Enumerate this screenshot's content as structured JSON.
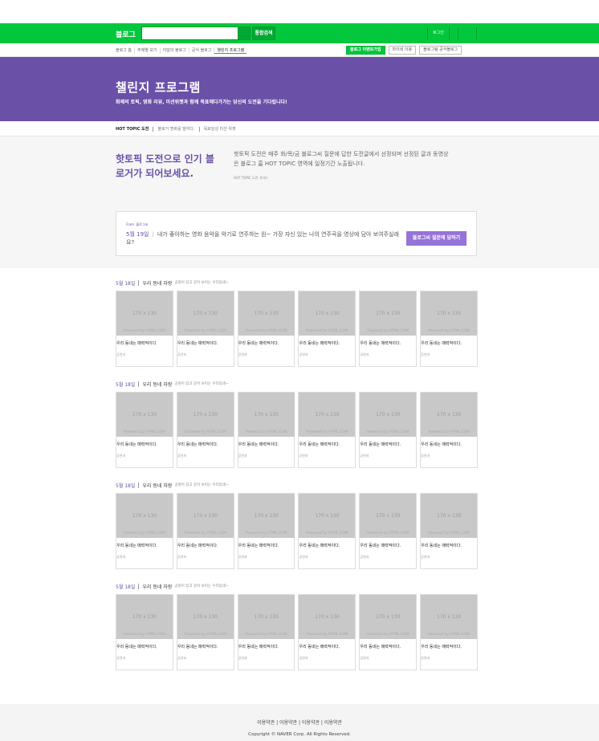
{
  "gnb": {
    "logo": "블로그",
    "search_button": "통합검색",
    "login": "로그인"
  },
  "lnb": {
    "menu": [
      "블로그 홈",
      "주제별 보기",
      "이달의 블로그",
      "공식 블로그",
      "챌린지 프로그램"
    ],
    "buttons": {
      "join": "블로그 이벤트가입",
      "mystore": "마이네 이용",
      "official": "블로그팀 공식블로그"
    }
  },
  "hero": {
    "title": "챌린지 프로그램",
    "subtitle": "화제의 토픽, 영화 리뷰, 미션위젯과 함께 목표에다가가는 당신의 도전을 기다립니다!"
  },
  "tabs": [
    "HOT TOPIC 도전",
    "블로거 명화를 말하다.",
    "목표달성 미션 위젯"
  ],
  "intro": {
    "headline": "핫토픽 도전으로 인기 블로거가 되어보세요.",
    "description": "핫토픽 도전은 매주 화/목/금 블로그씨 질문에 답한 도전글에서 선정되며 선정된 글과 동영상은 블로그 홈 HOT TOPIC 영역에 일정기간 노출됩니다.",
    "guide": "HOT TOPIC 도전 가이드",
    "question": {
      "from": "From. 블로그씨",
      "date": "5월 19일",
      "text": "내가 좋아하는 영화 음악을 악기로 연주하는 원~ 가장 자신 있는 나의 연주곡을 영상에 담아 보여주실래요?",
      "button": "블로그씨 질문에 답하기"
    }
  },
  "groups": [
    {
      "date": "5월 18일",
      "title": "우리 동네 자랑",
      "subtitle": "공원이 있고 강이 보이는 우리동네~",
      "cards": [
        {
          "size": "170 x 130",
          "powered": "Powered by HTML.COM",
          "title": "우리 동네는 매력적이다.",
          "author": "공연과"
        },
        {
          "size": "170 x 130",
          "powered": "Powered by HTML.COM",
          "title": "우리 동네는 매력적이다.",
          "author": "공연과"
        },
        {
          "size": "170 x 130",
          "powered": "Powered by HTML.COM",
          "title": "우리 동네는 매력적이다.",
          "author": "공연과"
        },
        {
          "size": "170 x 130",
          "powered": "Powered by HTML.COM",
          "title": "우리 동네는 매력적이다.",
          "author": "공연과"
        },
        {
          "size": "170 x 130",
          "powered": "Powered by HTML.COM",
          "title": "우리 동네는 매력적이다.",
          "author": "공연과"
        },
        {
          "size": "170 x 130",
          "powered": "Powered by HTML.COM",
          "title": "우리 동네는 매력적이다.",
          "author": "공연과"
        }
      ]
    },
    {
      "date": "5월 18일",
      "title": "우리 동네 자랑",
      "subtitle": "공원이 있고 강이 보이는 우리동네~",
      "cards": [
        {
          "size": "170 x 130",
          "powered": "Powered by HTML.COM",
          "title": "우리 동네는 매력적이다.",
          "author": "공연과"
        },
        {
          "size": "170 x 130",
          "powered": "Powered by HTML.COM",
          "title": "우리 동네는 매력적이다.",
          "author": "공연과"
        },
        {
          "size": "170 x 130",
          "powered": "Powered by HTML.COM",
          "title": "우리 동네는 매력적이다.",
          "author": "공연과"
        },
        {
          "size": "170 x 130",
          "powered": "Powered by HTML.COM",
          "title": "우리 동네는 매력적이다.",
          "author": "공연과"
        },
        {
          "size": "170 x 130",
          "powered": "Powered by HTML.COM",
          "title": "우리 동네는 매력적이다.",
          "author": "공연과"
        },
        {
          "size": "170 x 130",
          "powered": "Powered by HTML.COM",
          "title": "우리 동네는 매력적이다.",
          "author": "공연과"
        }
      ]
    },
    {
      "date": "5월 18일",
      "title": "우리 동네 자랑",
      "subtitle": "공원이 있고 강이 보이는 우리동네~",
      "cards": [
        {
          "size": "170 x 130",
          "powered": "Powered by HTML.COM",
          "title": "우리 동네는 매력적이다.",
          "author": "공연과"
        },
        {
          "size": "170 x 130",
          "powered": "Powered by HTML.COM",
          "title": "우리 동네는 매력적이다.",
          "author": "공연과"
        },
        {
          "size": "170 x 130",
          "powered": "Powered by HTML.COM",
          "title": "우리 동네는 매력적이다.",
          "author": "공연과"
        },
        {
          "size": "170 x 130",
          "powered": "Powered by HTML.COM",
          "title": "우리 동네는 매력적이다.",
          "author": "공연과"
        },
        {
          "size": "170 x 130",
          "powered": "Powered by HTML.COM",
          "title": "우리 동네는 매력적이다.",
          "author": "공연과"
        },
        {
          "size": "170 x 130",
          "powered": "Powered by HTML.COM",
          "title": "우리 동네는 매력적이다.",
          "author": "공연과"
        }
      ]
    },
    {
      "date": "5월 18일",
      "title": "우리 동네 자랑",
      "subtitle": "공원이 있고 강이 보이는 우리동네~",
      "cards": [
        {
          "size": "170 x 130",
          "powered": "Powered by HTML.COM",
          "title": "우리 동네는 매력적이다.",
          "author": "공연과"
        },
        {
          "size": "170 x 130",
          "powered": "Powered by HTML.COM",
          "title": "우리 동네는 매력적이다.",
          "author": "공연과"
        },
        {
          "size": "170 x 130",
          "powered": "Powered by HTML.COM",
          "title": "우리 동네는 매력적이다.",
          "author": "공연과"
        },
        {
          "size": "170 x 130",
          "powered": "Powered by HTML.COM",
          "title": "우리 동네는 매력적이다.",
          "author": "공연과"
        },
        {
          "size": "170 x 130",
          "powered": "Powered by HTML.COM",
          "title": "우리 동네는 매력적이다.",
          "author": "공연과"
        },
        {
          "size": "170 x 130",
          "powered": "Powered by HTML.COM",
          "title": "우리 동네는 매력적이다.",
          "author": "공연과"
        }
      ]
    }
  ],
  "footer": {
    "links": "이용약관 | 이용약관 | 이용약관 | 이용약관",
    "copyright": "Copyright © NAVER Corp. All Rights Reserved."
  },
  "colors": {
    "naver_green": "#02c73c",
    "challenge_purple": "#6a50a7",
    "button_purple": "#9673d9"
  }
}
